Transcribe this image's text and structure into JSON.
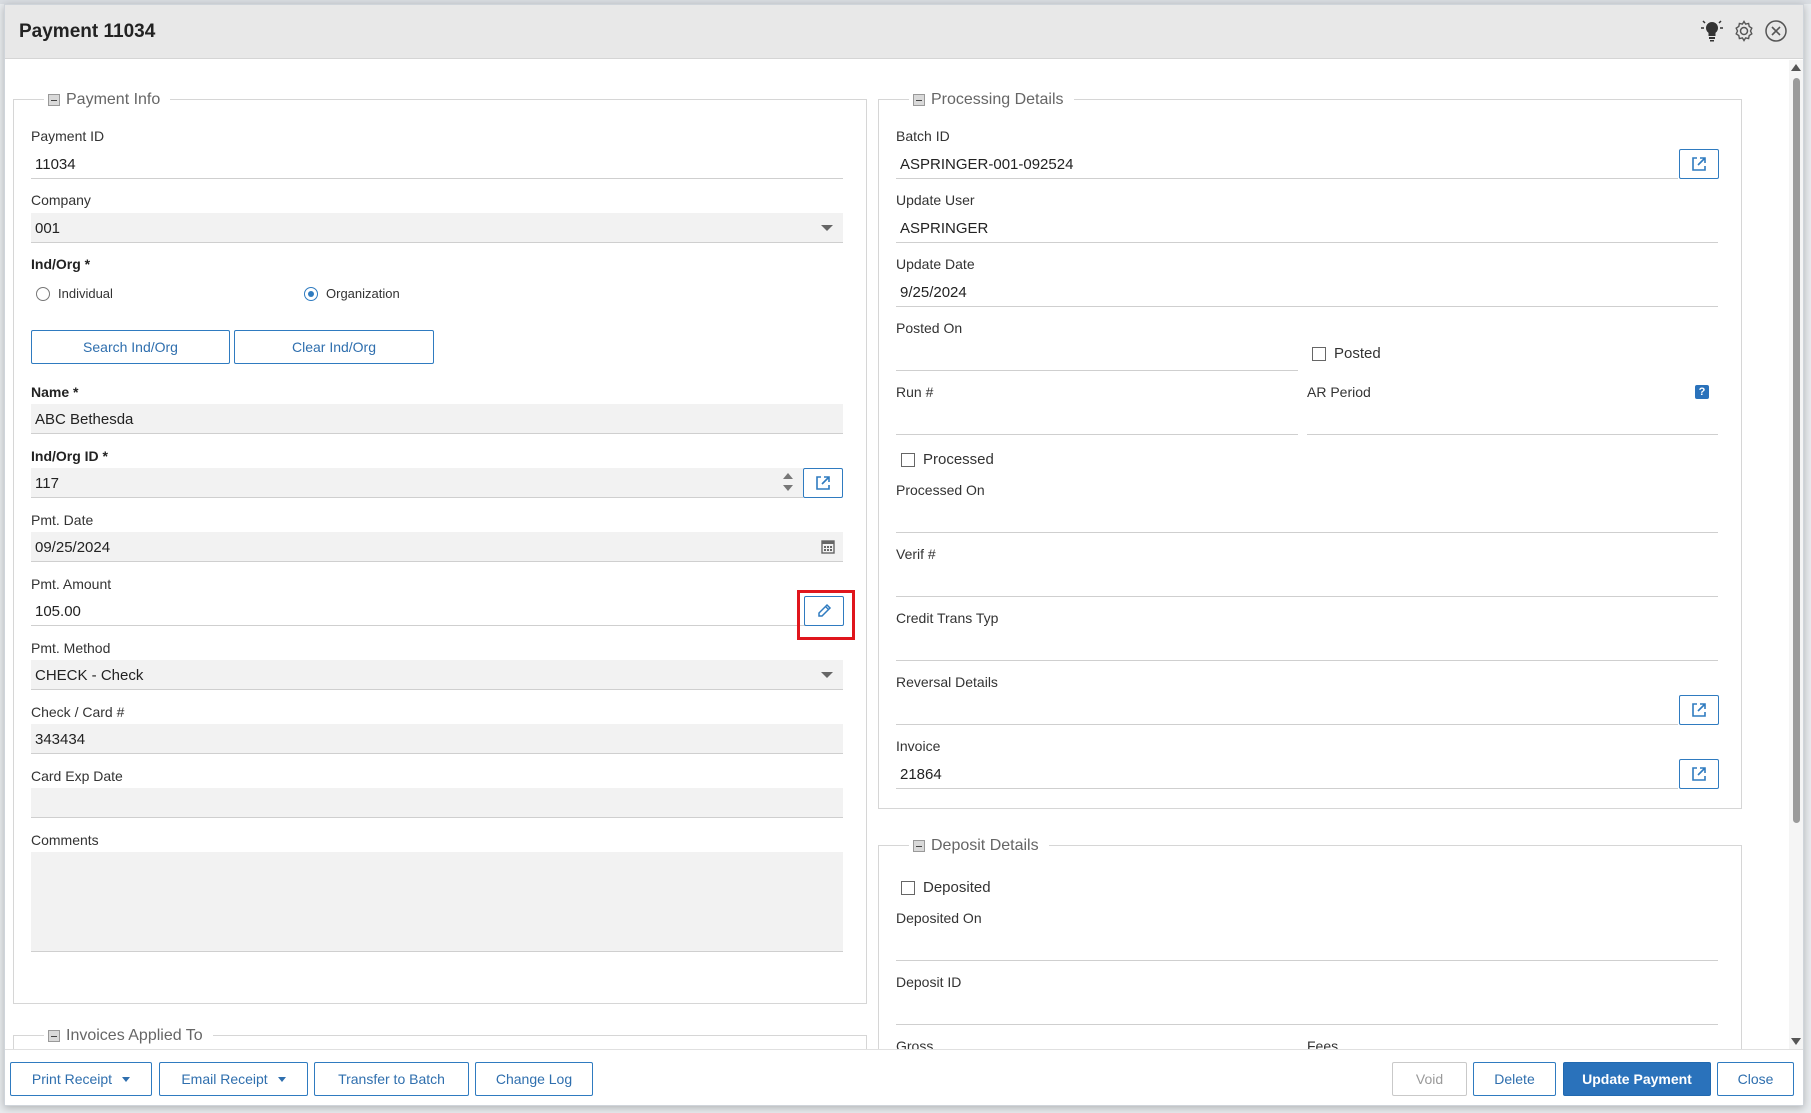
{
  "window": {
    "title": "Payment 11034"
  },
  "icons": {
    "hint": "lightbulb-icon",
    "settings": "gear-icon",
    "close": "close-circle-icon"
  },
  "payment_info": {
    "legend": "Payment Info",
    "payment_id_label": "Payment ID",
    "payment_id_value": "11034",
    "company_label": "Company",
    "company_value": "001",
    "indorg_label": "Ind/Org *",
    "radio_individual": "Individual",
    "radio_organization": "Organization",
    "radio_selected": "Organization",
    "search_btn": "Search Ind/Org",
    "clear_btn": "Clear Ind/Org",
    "name_label": "Name *",
    "name_value": "ABC Bethesda",
    "indorg_id_label": "Ind/Org ID *",
    "indorg_id_value": "117",
    "pmt_date_label": "Pmt. Date",
    "pmt_date_value": "09/25/2024",
    "pmt_amount_label": "Pmt. Amount",
    "pmt_amount_value": "105.00",
    "pmt_method_label": "Pmt. Method",
    "pmt_method_value": "CHECK - Check",
    "check_card_label": "Check / Card #",
    "check_card_value": "343434",
    "card_exp_label": "Card Exp Date",
    "card_exp_value": "",
    "comments_label": "Comments",
    "comments_value": ""
  },
  "invoices_applied": {
    "legend": "Invoices Applied To"
  },
  "processing": {
    "legend": "Processing Details",
    "batch_id_label": "Batch ID",
    "batch_id_value": "ASPRINGER-001-092524",
    "update_user_label": "Update User",
    "update_user_value": "ASPRINGER",
    "update_date_label": "Update Date",
    "update_date_value": "9/25/2024",
    "posted_on_label": "Posted On",
    "posted_on_value": "",
    "posted_cb": "Posted",
    "run_label": "Run #",
    "run_value": "",
    "ar_period_label": "AR Period",
    "ar_period_value": "",
    "ar_help": "?",
    "processed_cb": "Processed",
    "processed_on_label": "Processed On",
    "processed_on_value": "",
    "verif_label": "Verif #",
    "verif_value": "",
    "credit_trans_label": "Credit Trans Typ",
    "credit_trans_value": "",
    "reversal_label": "Reversal Details",
    "reversal_value": "",
    "invoice_label": "Invoice",
    "invoice_value": "21864"
  },
  "deposit": {
    "legend": "Deposit Details",
    "deposited_cb": "Deposited",
    "deposited_on_label": "Deposited On",
    "deposited_on_value": "",
    "deposit_id_label": "Deposit ID",
    "deposit_id_value": "",
    "gross_label": "Gross",
    "fees_label": "Fees"
  },
  "footer": {
    "print_receipt": "Print Receipt",
    "email_receipt": "Email Receipt",
    "transfer_batch": "Transfer to Batch",
    "change_log": "Change Log",
    "void": "Void",
    "delete": "Delete",
    "update_payment": "Update Payment",
    "close": "Close"
  },
  "colors": {
    "accent": "#2a72bb",
    "highlight": "#e0161c",
    "field_bg": "#f2f2f2"
  }
}
